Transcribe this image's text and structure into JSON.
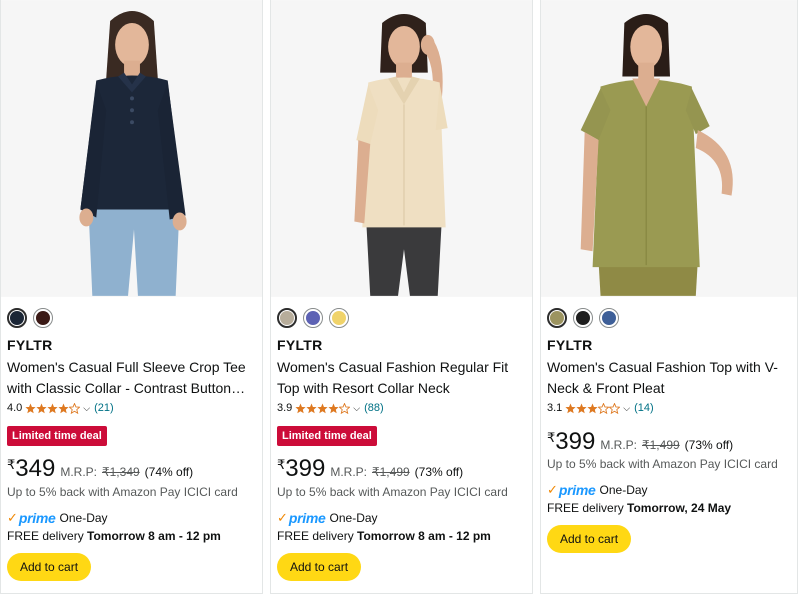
{
  "products": [
    {
      "brand": "FYLTR",
      "title": "Women's Casual Full Sleeve Crop Tee with Classic Collar - Contrast Button…",
      "rating": "4.0",
      "stars": 4,
      "review_count": "(21)",
      "deal_badge": "Limited time deal",
      "currency": "₹",
      "price": "349",
      "mrp_label": "M.R.P:",
      "mrp": "₹1,349",
      "discount": "(74% off)",
      "cashback": "Up to 5% back with Amazon Pay ICICI card",
      "prime_label": "prime",
      "prime_speed": "One-Day",
      "delivery_prefix": "FREE delivery",
      "delivery_time": "Tomorrow 8 am - 12 pm",
      "cta": "Add to cart",
      "swatch_colors": [
        "#1b2636",
        "#3b1a16"
      ],
      "image_icon": "model-navy-collar-top-photo"
    },
    {
      "brand": "FYLTR",
      "title": "Women's Casual Fashion Regular Fit Top with Resort Collar Neck",
      "rating": "3.9",
      "stars": 4,
      "review_count": "(88)",
      "deal_badge": "Limited time deal",
      "currency": "₹",
      "price": "399",
      "mrp_label": "M.R.P:",
      "mrp": "₹1,499",
      "discount": "(73% off)",
      "cashback": "Up to 5% back with Amazon Pay ICICI card",
      "prime_label": "prime",
      "prime_speed": "One-Day",
      "delivery_prefix": "FREE delivery",
      "delivery_time": "Tomorrow 8 am - 12 pm",
      "cta": "Add to cart",
      "swatch_colors": [
        "#b7ad9b",
        "#5d62b4",
        "#f0d36a"
      ],
      "image_icon": "model-beige-resort-collar-top-photo"
    },
    {
      "brand": "FYLTR",
      "title": "Women's Casual Fashion Top with V-Neck & Front Pleat",
      "rating": "3.1",
      "stars": 3,
      "review_count": "(14)",
      "currency": "₹",
      "price": "399",
      "mrp_label": "M.R.P:",
      "mrp": "₹1,499",
      "discount": "(73% off)",
      "cashback": "Up to 5% back with Amazon Pay ICICI card",
      "prime_label": "prime",
      "prime_speed": "One-Day",
      "delivery_prefix": "FREE delivery",
      "delivery_time": "Tomorrow, 24 May",
      "cta": "Add to cart",
      "swatch_colors": [
        "#9c9460",
        "#1e1e1e",
        "#3e5f98"
      ],
      "image_icon": "model-olive-vneck-top-photo"
    }
  ],
  "colors": {
    "deal_red": "#cc0c39",
    "cart_yellow": "#ffd814",
    "link_teal": "#007185",
    "star_orange": "#de7921",
    "prime_blue": "#1a98ff"
  }
}
